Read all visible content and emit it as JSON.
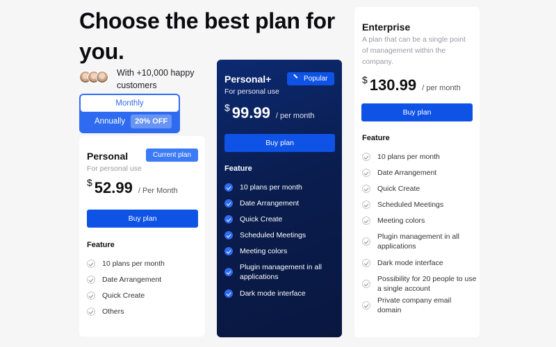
{
  "header": {
    "headline": "Choose the best plan for you.",
    "social_proof": "With +10,000 happy customers"
  },
  "billing_toggle": {
    "monthly_label": "Monthly",
    "annually_label": "Annually",
    "discount_badge": "20% OFF",
    "selected": "Monthly"
  },
  "plans": {
    "personal": {
      "name": "Personal",
      "subtitle": "For personal use",
      "badge": "Current plan",
      "currency": "$",
      "price": "52.99",
      "period": "/ Per Month",
      "button": "Buy plan",
      "feature_title": "Feature",
      "features": [
        "10 plans per month",
        "Date Arrangement",
        "Quick Create",
        "Others"
      ]
    },
    "plus": {
      "name": "Personal+",
      "subtitle": "For personal use",
      "badge": "Popular",
      "currency": "$",
      "price": "99.99",
      "period": "/ per month",
      "button": "Buy plan",
      "feature_title": "Feature",
      "features": [
        "10 plans per month",
        "Date Arrangement",
        "Quick Create",
        "Scheduled Meetings",
        "Meeting colors",
        "Plugin management in all applications",
        "Dark mode interface"
      ]
    },
    "enterprise": {
      "name": "Enterprise",
      "subtitle": "A plan that can be a single point of management within the company.",
      "currency": "$",
      "price": "130.99",
      "period": "/ per month",
      "button": "Buy plan",
      "feature_title": "Feature",
      "features": [
        "10 plans per month",
        "Date Arrangement",
        "Quick Create",
        "Scheduled Meetings",
        "Meeting colors",
        "Plugin management in all applications",
        "Dark mode interface",
        "Possibility for 20 people to use a single account",
        "Private company email domain"
      ]
    }
  },
  "colors": {
    "accent": "#0e52e6",
    "badge_blue": "#3b7bf5",
    "dark_card": "#0a1d4f",
    "background": "#f6f6f7"
  }
}
